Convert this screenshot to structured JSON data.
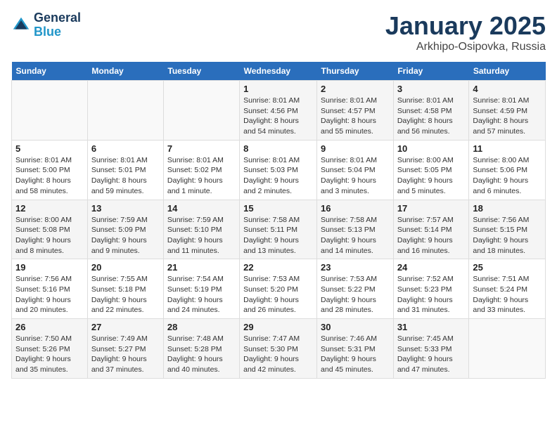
{
  "header": {
    "logo_line1": "General",
    "logo_line2": "Blue",
    "month": "January 2025",
    "location": "Arkhipo-Osipovka, Russia"
  },
  "weekdays": [
    "Sunday",
    "Monday",
    "Tuesday",
    "Wednesday",
    "Thursday",
    "Friday",
    "Saturday"
  ],
  "weeks": [
    [
      {
        "day": "",
        "text": ""
      },
      {
        "day": "",
        "text": ""
      },
      {
        "day": "",
        "text": ""
      },
      {
        "day": "1",
        "text": "Sunrise: 8:01 AM\nSunset: 4:56 PM\nDaylight: 8 hours\nand 54 minutes."
      },
      {
        "day": "2",
        "text": "Sunrise: 8:01 AM\nSunset: 4:57 PM\nDaylight: 8 hours\nand 55 minutes."
      },
      {
        "day": "3",
        "text": "Sunrise: 8:01 AM\nSunset: 4:58 PM\nDaylight: 8 hours\nand 56 minutes."
      },
      {
        "day": "4",
        "text": "Sunrise: 8:01 AM\nSunset: 4:59 PM\nDaylight: 8 hours\nand 57 minutes."
      }
    ],
    [
      {
        "day": "5",
        "text": "Sunrise: 8:01 AM\nSunset: 5:00 PM\nDaylight: 8 hours\nand 58 minutes."
      },
      {
        "day": "6",
        "text": "Sunrise: 8:01 AM\nSunset: 5:01 PM\nDaylight: 8 hours\nand 59 minutes."
      },
      {
        "day": "7",
        "text": "Sunrise: 8:01 AM\nSunset: 5:02 PM\nDaylight: 9 hours\nand 1 minute."
      },
      {
        "day": "8",
        "text": "Sunrise: 8:01 AM\nSunset: 5:03 PM\nDaylight: 9 hours\nand 2 minutes."
      },
      {
        "day": "9",
        "text": "Sunrise: 8:01 AM\nSunset: 5:04 PM\nDaylight: 9 hours\nand 3 minutes."
      },
      {
        "day": "10",
        "text": "Sunrise: 8:00 AM\nSunset: 5:05 PM\nDaylight: 9 hours\nand 5 minutes."
      },
      {
        "day": "11",
        "text": "Sunrise: 8:00 AM\nSunset: 5:06 PM\nDaylight: 9 hours\nand 6 minutes."
      }
    ],
    [
      {
        "day": "12",
        "text": "Sunrise: 8:00 AM\nSunset: 5:08 PM\nDaylight: 9 hours\nand 8 minutes."
      },
      {
        "day": "13",
        "text": "Sunrise: 7:59 AM\nSunset: 5:09 PM\nDaylight: 9 hours\nand 9 minutes."
      },
      {
        "day": "14",
        "text": "Sunrise: 7:59 AM\nSunset: 5:10 PM\nDaylight: 9 hours\nand 11 minutes."
      },
      {
        "day": "15",
        "text": "Sunrise: 7:58 AM\nSunset: 5:11 PM\nDaylight: 9 hours\nand 13 minutes."
      },
      {
        "day": "16",
        "text": "Sunrise: 7:58 AM\nSunset: 5:13 PM\nDaylight: 9 hours\nand 14 minutes."
      },
      {
        "day": "17",
        "text": "Sunrise: 7:57 AM\nSunset: 5:14 PM\nDaylight: 9 hours\nand 16 minutes."
      },
      {
        "day": "18",
        "text": "Sunrise: 7:56 AM\nSunset: 5:15 PM\nDaylight: 9 hours\nand 18 minutes."
      }
    ],
    [
      {
        "day": "19",
        "text": "Sunrise: 7:56 AM\nSunset: 5:16 PM\nDaylight: 9 hours\nand 20 minutes."
      },
      {
        "day": "20",
        "text": "Sunrise: 7:55 AM\nSunset: 5:18 PM\nDaylight: 9 hours\nand 22 minutes."
      },
      {
        "day": "21",
        "text": "Sunrise: 7:54 AM\nSunset: 5:19 PM\nDaylight: 9 hours\nand 24 minutes."
      },
      {
        "day": "22",
        "text": "Sunrise: 7:53 AM\nSunset: 5:20 PM\nDaylight: 9 hours\nand 26 minutes."
      },
      {
        "day": "23",
        "text": "Sunrise: 7:53 AM\nSunset: 5:22 PM\nDaylight: 9 hours\nand 28 minutes."
      },
      {
        "day": "24",
        "text": "Sunrise: 7:52 AM\nSunset: 5:23 PM\nDaylight: 9 hours\nand 31 minutes."
      },
      {
        "day": "25",
        "text": "Sunrise: 7:51 AM\nSunset: 5:24 PM\nDaylight: 9 hours\nand 33 minutes."
      }
    ],
    [
      {
        "day": "26",
        "text": "Sunrise: 7:50 AM\nSunset: 5:26 PM\nDaylight: 9 hours\nand 35 minutes."
      },
      {
        "day": "27",
        "text": "Sunrise: 7:49 AM\nSunset: 5:27 PM\nDaylight: 9 hours\nand 37 minutes."
      },
      {
        "day": "28",
        "text": "Sunrise: 7:48 AM\nSunset: 5:28 PM\nDaylight: 9 hours\nand 40 minutes."
      },
      {
        "day": "29",
        "text": "Sunrise: 7:47 AM\nSunset: 5:30 PM\nDaylight: 9 hours\nand 42 minutes."
      },
      {
        "day": "30",
        "text": "Sunrise: 7:46 AM\nSunset: 5:31 PM\nDaylight: 9 hours\nand 45 minutes."
      },
      {
        "day": "31",
        "text": "Sunrise: 7:45 AM\nSunset: 5:33 PM\nDaylight: 9 hours\nand 47 minutes."
      },
      {
        "day": "",
        "text": ""
      }
    ]
  ]
}
